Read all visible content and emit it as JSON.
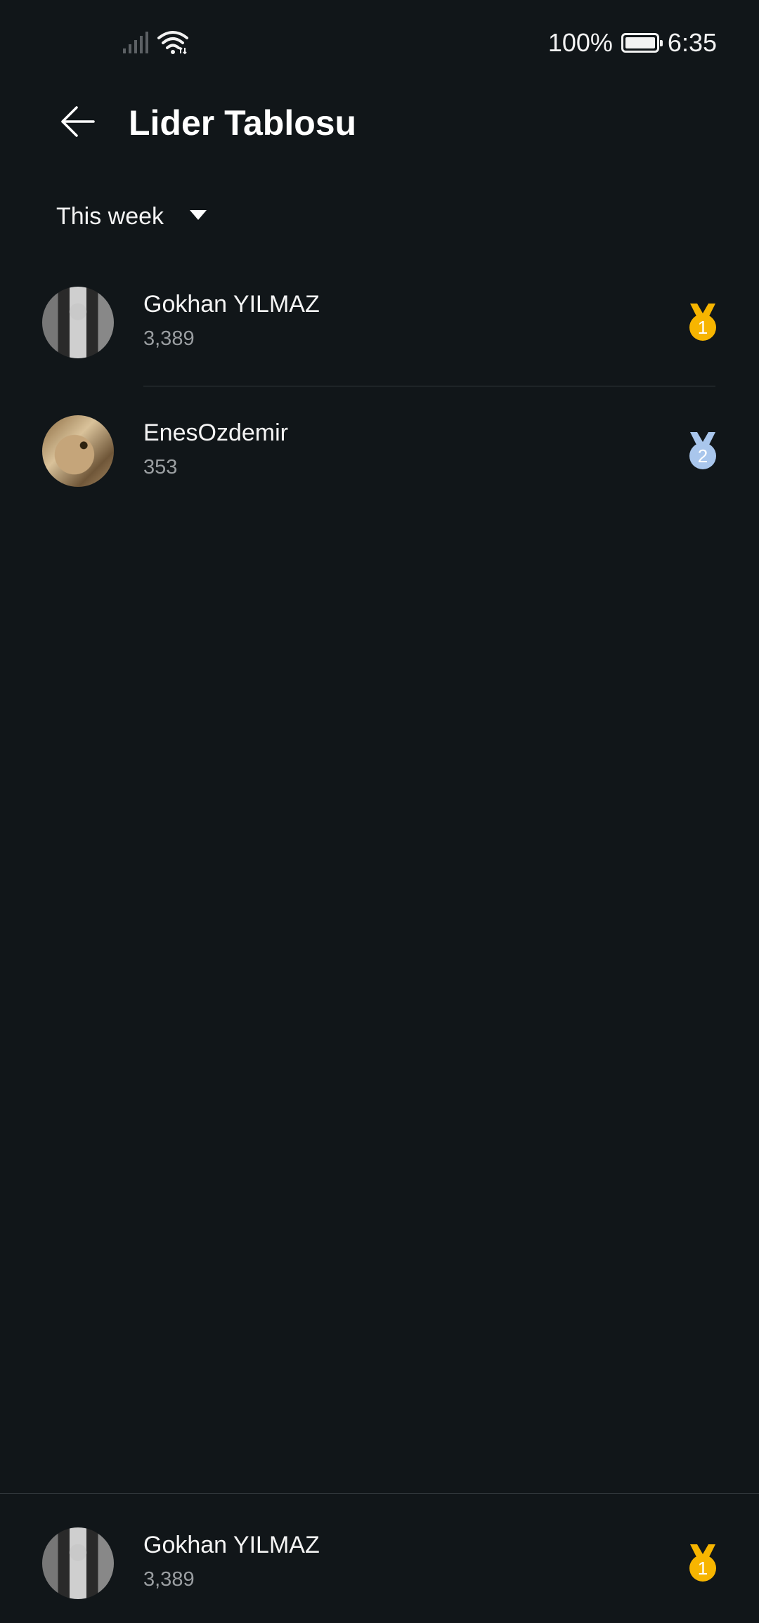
{
  "status_bar": {
    "battery_percent": "100%",
    "time": "6:35",
    "icons": [
      "signal-icon",
      "wifi-icon",
      "battery-icon"
    ]
  },
  "header": {
    "title": "Lider Tablosu",
    "back_icon": "arrow-left-icon"
  },
  "filter": {
    "selected": "This week",
    "icon": "dropdown-triangle-icon"
  },
  "leaderboard": [
    {
      "name": "Gokhan YILMAZ",
      "score": "3,389",
      "rank": "1",
      "medal_color": "#f7b500"
    },
    {
      "name": "EnesOzdemir",
      "score": "353",
      "rank": "2",
      "medal_color": "#a9c6ec"
    }
  ],
  "current_user": {
    "name": "Gokhan YILMAZ",
    "score": "3,389",
    "rank": "1",
    "medal_color": "#f7b500"
  },
  "colors": {
    "background": "#111619",
    "divider": "#33393d",
    "secondary_text": "#9a9ea1",
    "gold": "#f7b500",
    "silver": "#a9c6ec"
  }
}
